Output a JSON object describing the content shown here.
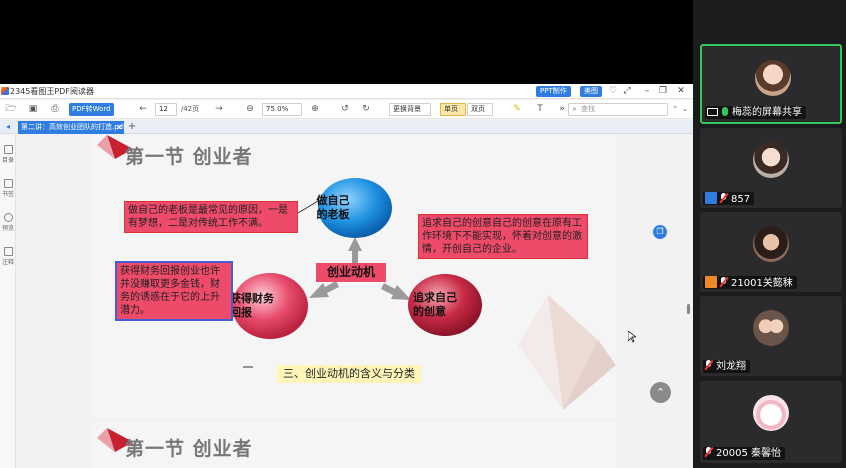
{
  "viewer": {
    "app_title": "2345看图王PDF阅读器",
    "ppt_badge": "PPT制作",
    "beautify_badge": "美图",
    "pdf_to_word": "PDF转Word",
    "page_current": "12",
    "page_total": "/42页",
    "zoom": "75.0%",
    "bg_select": "更换背景",
    "single_page": "单页",
    "double_page": "双页",
    "search_placeholder": "查找",
    "tab_title": "第二讲：高效创业团队的打造.pdf",
    "sidebar": [
      {
        "label": "目录"
      },
      {
        "label": "书签"
      },
      {
        "label": "预览"
      },
      {
        "label": "注释"
      }
    ]
  },
  "slide": {
    "heading": "第一节 创业者",
    "center_label": "创业动机",
    "circle_top": "做自己\n的老板",
    "circle_left": "获得财务\n回报",
    "circle_right": "追求自己\n的创意",
    "callout_top": "做自己的老板是最常见的原因，一是有梦想，二是对传统工作不满。",
    "callout_left": "获得财务回报创业也许并没赚取更多金钱，财务的诱惑在于它的上升潜力。",
    "callout_right": "追求自己的创意自己的创意在原有工作环境下不能实现，怀着对创意的激情，开创自己的企业。",
    "footer_caption": "三、创业动机的含义与分类",
    "next_heading": "第一节 创业者"
  },
  "participants": [
    {
      "name": "梅蕊的屏幕共享",
      "active": true
    },
    {
      "name": "857"
    },
    {
      "name": "21001关懿秣"
    },
    {
      "name": "刘龙翔"
    },
    {
      "name": "20005 秦馨怡"
    }
  ],
  "colors": {
    "accent": "#2f7de1",
    "callout": "#ee4a6a",
    "active_border": "#34c759",
    "circle_blue": "#1e90e0",
    "circle_pink": "#e84a6a"
  }
}
